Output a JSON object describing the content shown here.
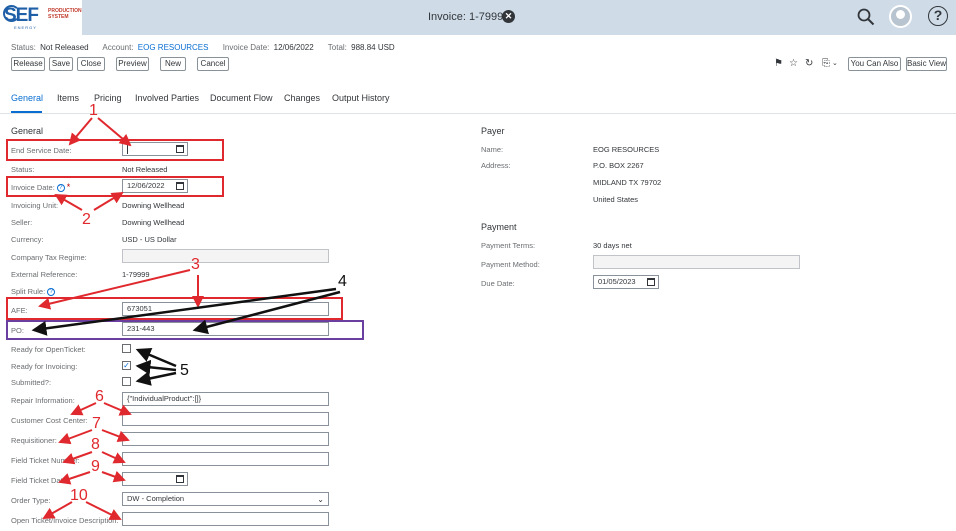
{
  "shell": {
    "logo_text": "SEF",
    "logo_sub1": "PRODUCTION",
    "logo_sub2": "SYSTEM",
    "logo_energy": "ENERGY",
    "title": "Invoice: 1-79999"
  },
  "header": {
    "status_label": "Status:",
    "status_value": "Not Released",
    "account_label": "Account:",
    "account_value": "EOG RESOURCES",
    "invoice_date_label": "Invoice Date:",
    "invoice_date_value": "12/06/2022",
    "total_label": "Total:",
    "total_value": "988.84 USD"
  },
  "toolbar": {
    "release": "Release",
    "save": "Save",
    "close": "Close",
    "preview": "Preview",
    "new": "New",
    "cancel": "Cancel",
    "you_can_also": "You Can Also",
    "basic_view": "Basic View"
  },
  "tabs": [
    "General",
    "Items",
    "Pricing",
    "Involved Parties",
    "Document Flow",
    "Changes",
    "Output History"
  ],
  "general": {
    "title": "General",
    "end_service_date_label": "End Service Date:",
    "end_service_date_value": "",
    "status_label": "Status:",
    "status_value": "Not Released",
    "invoice_date_label": "Invoice Date:",
    "invoice_date_value": "12/06/2022",
    "invoicing_unit_label": "Invoicing Unit:",
    "invoicing_unit_value": "Downing Wellhead",
    "seller_label": "Seller:",
    "seller_value": "Downing Wellhead",
    "currency_label": "Currency:",
    "currency_value": "USD - US Dollar",
    "company_tax_label": "Company Tax Regime:",
    "company_tax_value": "",
    "external_ref_label": "External Reference:",
    "external_ref_value": "1-79999",
    "split_rule_label": "Split Rule:",
    "afe_label": "AFE:",
    "afe_value": "673051",
    "po_label": "PO:",
    "po_value": "231-443",
    "ready_openticket_label": "Ready for OpenTicket:",
    "ready_openticket_checked": false,
    "ready_invoicing_label": "Ready for Invoicing:",
    "ready_invoicing_checked": true,
    "submitted_label": "Submitted?:",
    "submitted_checked": false,
    "repair_info_label": "Repair Information:",
    "repair_info_value": "{\"IndividualProduct\":[]}",
    "customer_cost_center_label": "Customer Cost Center:",
    "customer_cost_center_value": "",
    "requisitioner_label": "Requisitioner:",
    "requisitioner_value": "",
    "field_ticket_number_label": "Field Ticket Number:",
    "field_ticket_number_value": "",
    "field_ticket_date_label": "Field Ticket Date:",
    "field_ticket_date_value": "",
    "order_type_label": "Order Type:",
    "order_type_value": "DW - Completion",
    "open_ticket_desc_label": "Open Ticket/Invoice Description:",
    "open_ticket_desc_value": ""
  },
  "payer": {
    "title": "Payer",
    "name_label": "Name:",
    "name_value": "EOG RESOURCES",
    "address_label": "Address:",
    "address_line1": "P.O. BOX 2267",
    "address_line2": "MIDLAND TX  79702",
    "address_line3": "United States"
  },
  "payment": {
    "title": "Payment",
    "terms_label": "Payment Terms:",
    "terms_value": "30 days net",
    "method_label": "Payment Method:",
    "method_value": "",
    "due_date_label": "Due Date:",
    "due_date_value": "01/05/2023"
  },
  "annotations": [
    "1",
    "2",
    "3",
    "4",
    "5",
    "6",
    "7",
    "8",
    "9",
    "10"
  ],
  "colors": {
    "accent": "#0a6ed1",
    "shell": "#cfdce8",
    "annotation_red": "#e0292e",
    "annotation_purple": "#6b3fa0"
  }
}
